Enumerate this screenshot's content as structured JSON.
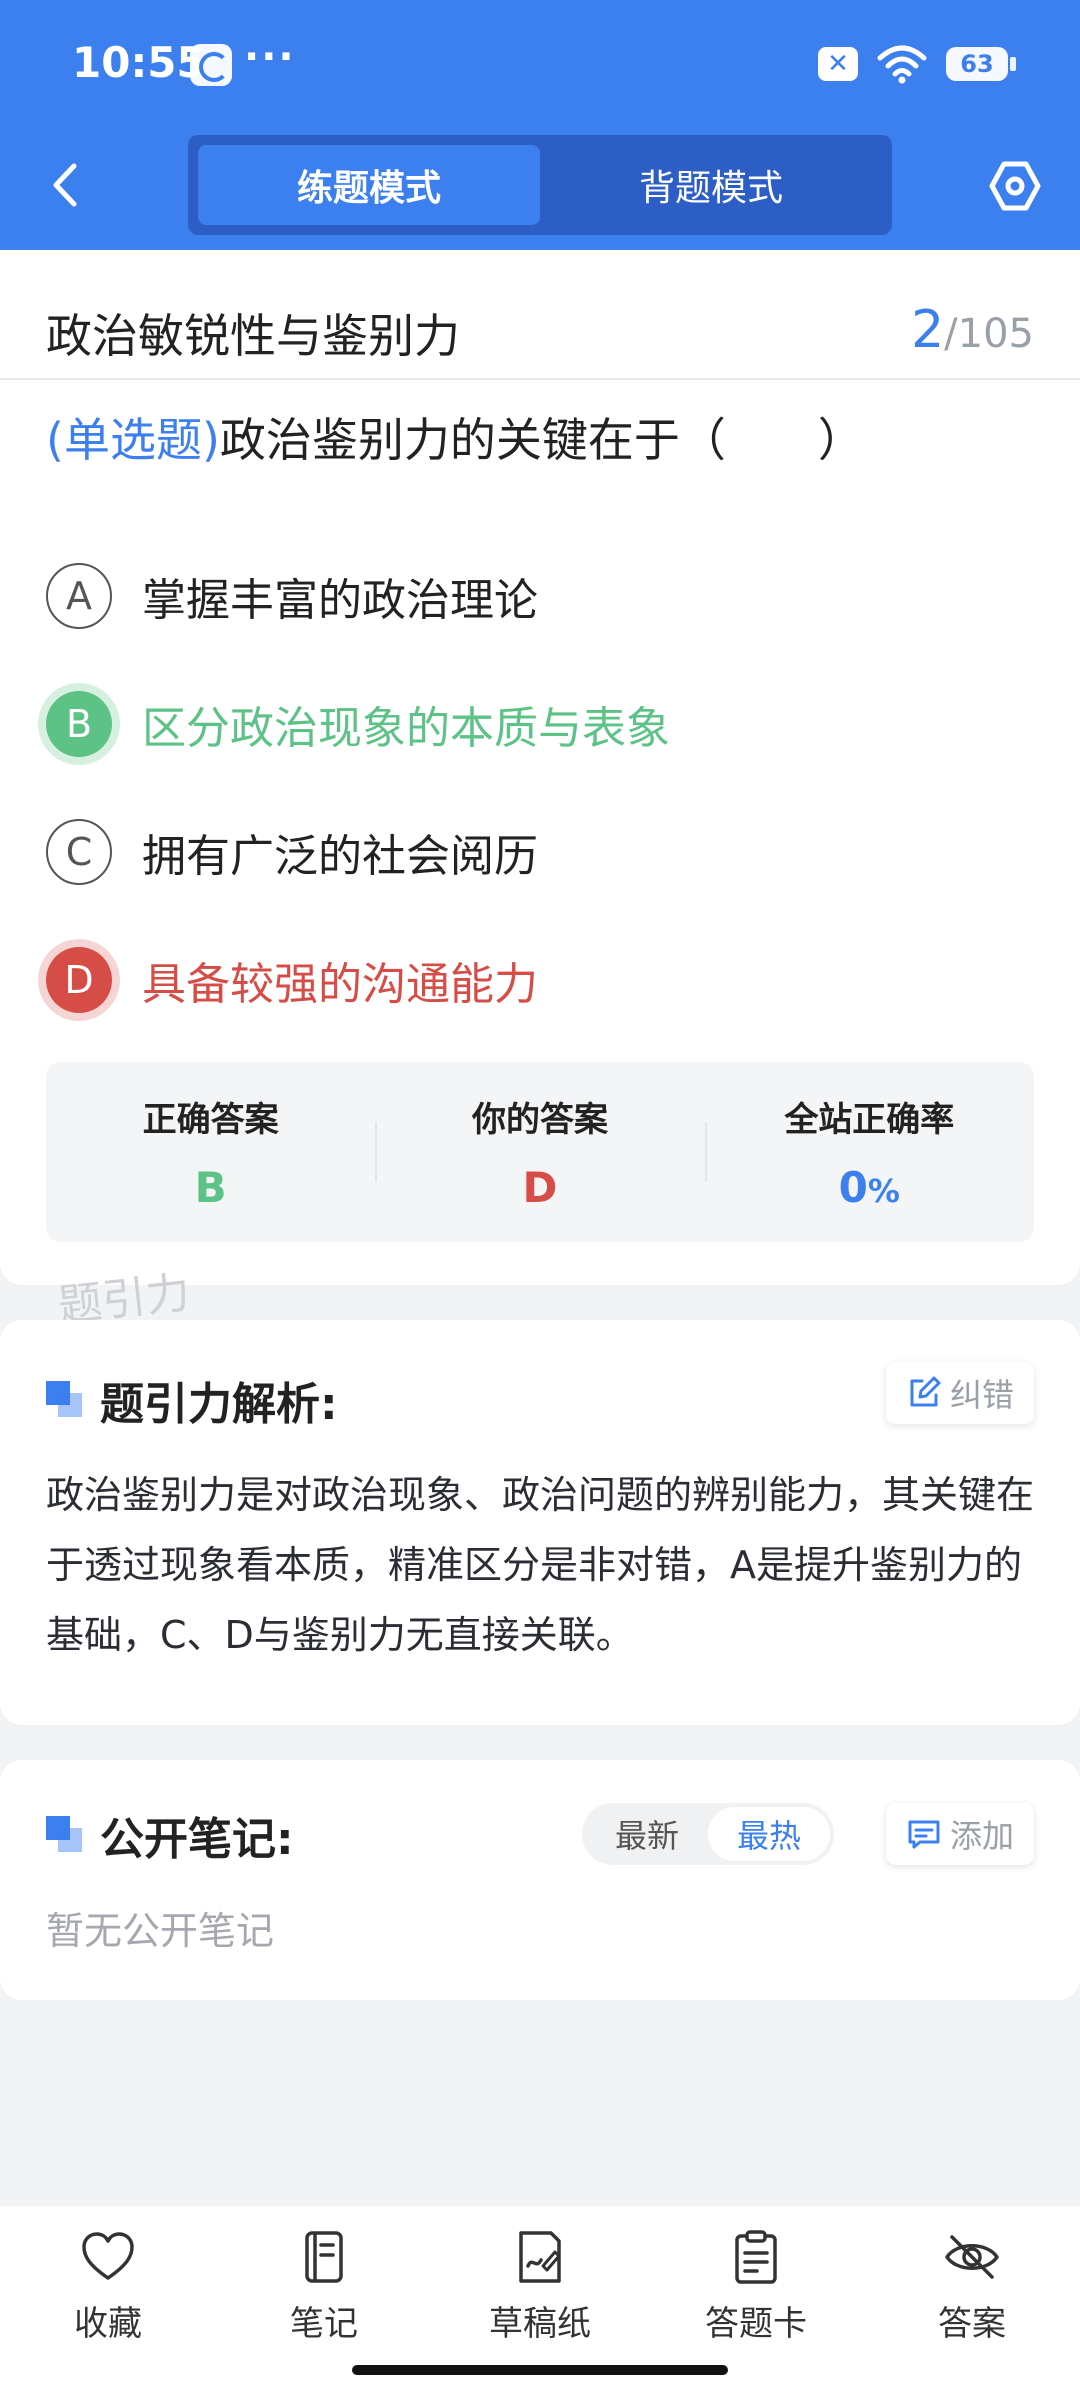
{
  "status_bar": {
    "time": "10:55",
    "more": "···",
    "battery": "63"
  },
  "header": {
    "tabs": [
      {
        "label": "练题模式",
        "active": true
      },
      {
        "label": "背题模式",
        "active": false
      }
    ]
  },
  "question": {
    "category": "政治敏锐性与鉴别力",
    "progress_current": "2",
    "progress_total": "/105",
    "type": "(单选题)",
    "stem": "政治鉴别力的关键在于（　　）",
    "options": [
      {
        "letter": "A",
        "text": "掌握丰富的政治理论",
        "state": "normal"
      },
      {
        "letter": "B",
        "text": "区分政治现象的本质与表象",
        "state": "correct"
      },
      {
        "letter": "C",
        "text": "拥有广泛的社会阅历",
        "state": "normal"
      },
      {
        "letter": "D",
        "text": "具备较强的沟通能力",
        "state": "wrong"
      }
    ],
    "stats": {
      "correct_label": "正确答案",
      "correct_value": "B",
      "yours_label": "你的答案",
      "yours_value": "D",
      "rate_label": "全站正确率",
      "rate_value": "0",
      "rate_unit": "%"
    }
  },
  "watermark": "题引力",
  "analysis": {
    "title": "题引力解析:",
    "report_label": "纠错",
    "text": "政治鉴别力是对政治现象、政治问题的辨别能力，其关键在于透过现象看本质，精准区分是非对错，A是提升鉴别力的基础，C、D与鉴别力无直接关联。"
  },
  "notes": {
    "title": "公开笔记:",
    "sort_options": [
      {
        "label": "最新",
        "active": false
      },
      {
        "label": "最热",
        "active": true
      }
    ],
    "add_label": "添加",
    "empty_text": "暂无公开笔记"
  },
  "bottom_bar": [
    {
      "label": "收藏",
      "icon": "heart-icon"
    },
    {
      "label": "笔记",
      "icon": "notebook-icon"
    },
    {
      "label": "草稿纸",
      "icon": "draft-icon"
    },
    {
      "label": "答题卡",
      "icon": "answer-card-icon"
    },
    {
      "label": "答案",
      "icon": "eye-off-icon"
    }
  ],
  "colors": {
    "primary": "#3C7FEF",
    "correct": "#5CC285",
    "wrong": "#D64D48"
  }
}
